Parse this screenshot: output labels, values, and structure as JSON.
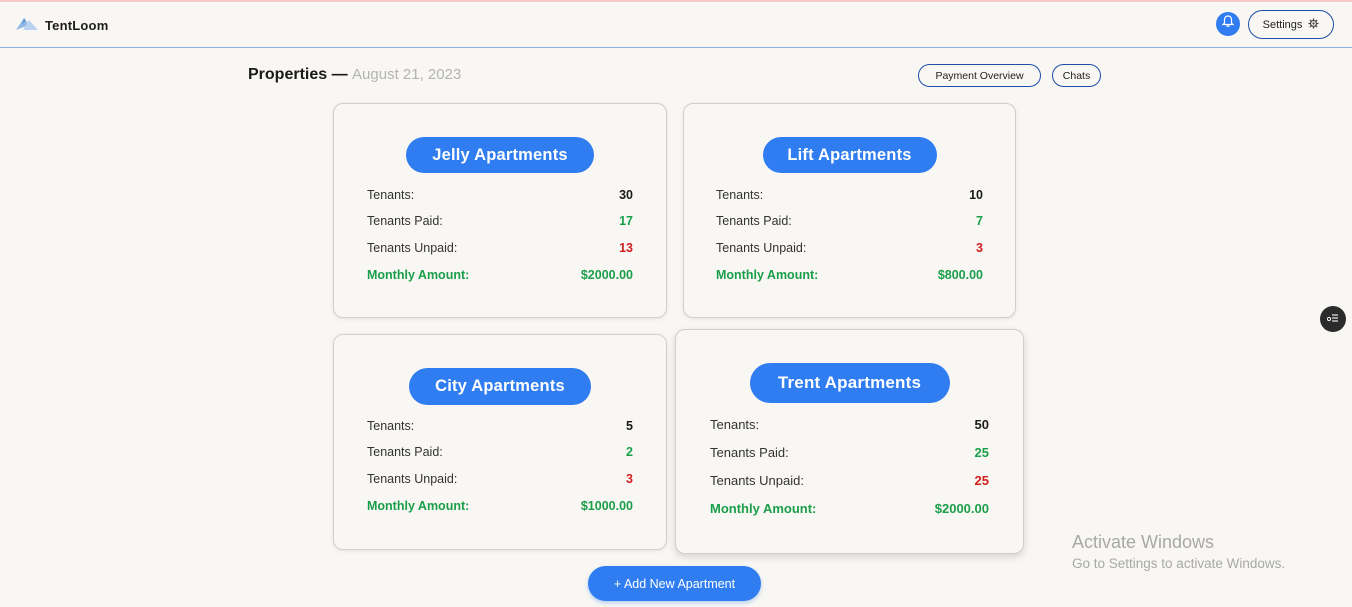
{
  "navbar": {
    "brand": "TentLoom",
    "settings_label": "Settings"
  },
  "header": {
    "title": "Properties",
    "separator": "—",
    "date": "August 21, 2023"
  },
  "links": {
    "payment_overview": "Payment Overview",
    "chats": "Chats"
  },
  "labels": {
    "tenants": "Tenants:",
    "tenants_paid": "Tenants Paid:",
    "tenants_unpaid": "Tenants Unpaid:",
    "monthly_amount": "Monthly Amount:"
  },
  "properties": [
    {
      "name": "Jelly Apartments",
      "tenants": "30",
      "paid": "17",
      "unpaid": "13",
      "amount": "$2000.00"
    },
    {
      "name": "Lift Apartments",
      "tenants": "10",
      "paid": "7",
      "unpaid": "3",
      "amount": "$800.00"
    },
    {
      "name": "City Apartments",
      "tenants": "5",
      "paid": "2",
      "unpaid": "3",
      "amount": "$1000.00"
    },
    {
      "name": "Trent Apartments",
      "tenants": "50",
      "paid": "25",
      "unpaid": "25",
      "amount": "$2000.00"
    }
  ],
  "add_button": "+ Add New Apartment",
  "watermark": {
    "title": "Activate Windows",
    "subtitle": "Go to Settings to activate Windows."
  },
  "colors": {
    "accent": "#2f7df0",
    "paid": "#1a9e4a",
    "unpaid": "#d11e1e",
    "background": "#f9f7f3"
  },
  "icons": [
    "logo-tent-icon",
    "bell-icon",
    "gear-icon",
    "widget-icon"
  ]
}
